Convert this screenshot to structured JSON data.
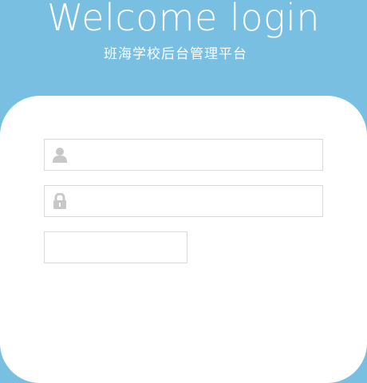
{
  "header": {
    "title": "Welcome login",
    "subtitle": "班海学校后台管理平台"
  },
  "form": {
    "username": {
      "icon": "user-icon",
      "value": "",
      "placeholder": ""
    },
    "password": {
      "icon": "lock-icon",
      "value": "",
      "placeholder": ""
    },
    "captcha": {
      "value": "",
      "placeholder": ""
    }
  },
  "colors": {
    "background": "#78bfe2",
    "card": "#ffffff",
    "field_border": "#d9d9d9",
    "icon": "#c8c8c8"
  }
}
